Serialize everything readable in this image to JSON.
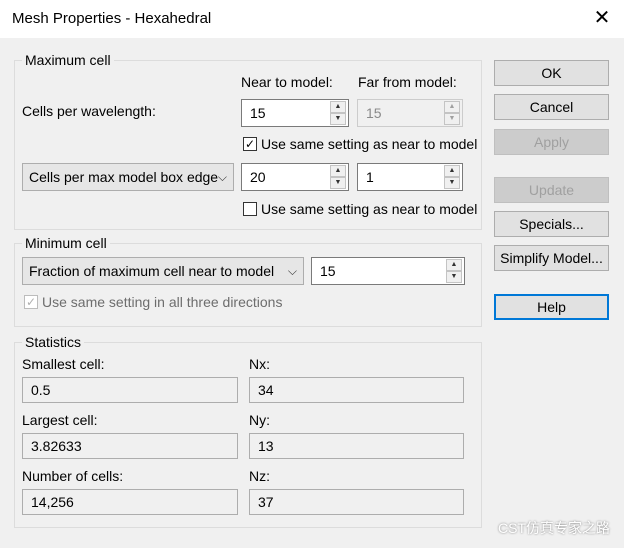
{
  "window": {
    "title": "Mesh Properties - Hexahedral",
    "close_glyph": "✕"
  },
  "maximum_cell": {
    "legend": "Maximum cell",
    "near_header": "Near to model:",
    "far_header": "Far from model:",
    "cells_per_wavelength_label": "Cells per wavelength:",
    "cpw_near_value": "15",
    "cpw_far_value": "15",
    "use_same_1": {
      "label": "Use same setting as near to model",
      "checked": true
    },
    "edge_combo_value": "Cells per max model box edge",
    "edge_near_value": "20",
    "edge_far_value": "1",
    "use_same_2": {
      "label": "Use same setting as near to model",
      "checked": false
    }
  },
  "minimum_cell": {
    "legend": "Minimum cell",
    "combo_value": "Fraction of maximum cell near to model",
    "value": "15",
    "use_same_dirs": {
      "label": "Use same setting in all three directions",
      "checked": true,
      "disabled": true
    }
  },
  "statistics": {
    "legend": "Statistics",
    "smallest_label": "Smallest cell:",
    "smallest_value": "0.5",
    "largest_label": "Largest cell:",
    "largest_value": "3.82633",
    "count_label": "Number of cells:",
    "count_value": "14,256",
    "nx_label": "Nx:",
    "nx_value": "34",
    "ny_label": "Ny:",
    "ny_value": "13",
    "nz_label": "Nz:",
    "nz_value": "37"
  },
  "buttons": {
    "ok": "OK",
    "cancel": "Cancel",
    "apply": "Apply",
    "update": "Update",
    "specials": "Specials...",
    "simplify": "Simplify Model...",
    "help": "Help"
  },
  "watermark": "CST仿真专家之路",
  "glyphs": {
    "check": "✓",
    "combo_arrow": "⌵",
    "spin_up": "▲",
    "spin_down": "▼"
  },
  "colors": {
    "default_button_border": "#0078d7",
    "dialog_bg": "#f0f0f0"
  }
}
